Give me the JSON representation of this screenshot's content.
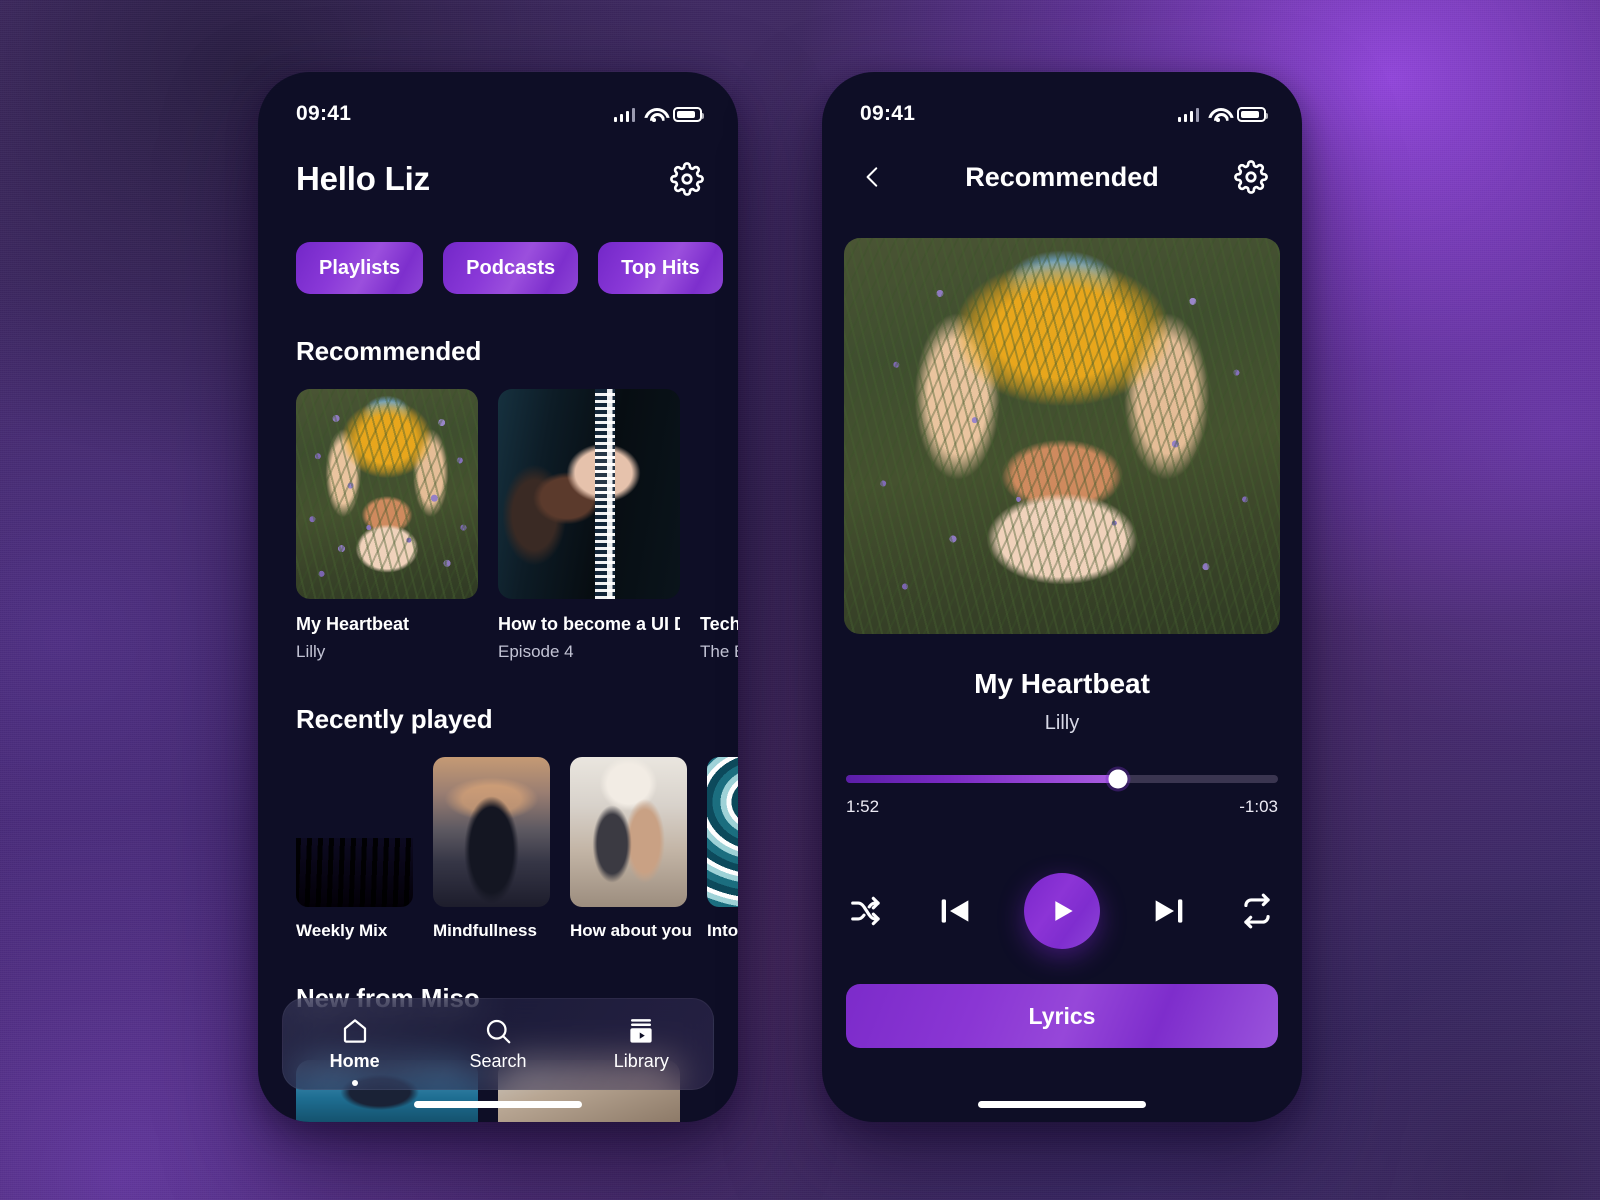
{
  "theme": {
    "screen_bg": "#0e0e26",
    "accent_purple": "#8a36d4",
    "accent_purple_dark": "#5b1ea8",
    "text_primary": "#ffffff",
    "text_secondary": "#c2c3d4",
    "backdrop_purple": "#4a3070"
  },
  "home_screen": {
    "status_bar": {
      "time": "09:41",
      "signal_icon": "cellular-signal-icon",
      "wifi_icon": "wifi-icon",
      "battery_icon": "battery-icon"
    },
    "greeting": "Hello Liz",
    "settings_icon": "gear-icon",
    "chips": [
      {
        "label": "Playlists"
      },
      {
        "label": "Podcasts"
      },
      {
        "label": "Top Hits"
      }
    ],
    "recommended": {
      "title": "Recommended",
      "items": [
        {
          "title": "My Heartbeat",
          "subtitle": "Lilly",
          "art": "art-lavender"
        },
        {
          "title": "How to become a UI D",
          "subtitle": "Episode 4",
          "art": "art-hands"
        },
        {
          "title": "Techni",
          "subtitle": "The Bols",
          "art": "art-radio"
        }
      ]
    },
    "recently_played": {
      "title": "Recently played",
      "items": [
        {
          "title": "Weekly Mix",
          "art": "art-concert"
        },
        {
          "title": "Mindfullness",
          "art": "art-sunset"
        },
        {
          "title": "How about you",
          "art": "art-friends"
        },
        {
          "title": "Intoxic",
          "art": "art-marble"
        }
      ]
    },
    "new_from": {
      "title": "New from Miso"
    },
    "tabbar": {
      "items": [
        {
          "label": "Home",
          "icon": "home-icon",
          "active": true
        },
        {
          "label": "Search",
          "icon": "search-icon",
          "active": false
        },
        {
          "label": "Library",
          "icon": "library-icon",
          "active": false
        }
      ]
    }
  },
  "player_screen": {
    "status_bar": {
      "time": "09:41",
      "signal_icon": "cellular-signal-icon",
      "wifi_icon": "wifi-icon",
      "battery_icon": "battery-icon"
    },
    "back_icon": "chevron-left-icon",
    "title": "Recommended",
    "settings_icon": "gear-icon",
    "cover_art": "art-lavender",
    "track_title": "My Heartbeat",
    "track_artist": "Lilly",
    "progress": {
      "elapsed": "1:52",
      "remaining": "-1:03",
      "percent": 63
    },
    "controls": {
      "shuffle_icon": "shuffle-icon",
      "previous_icon": "skip-previous-icon",
      "play_icon": "play-icon",
      "next_icon": "skip-next-icon",
      "repeat_icon": "repeat-icon"
    },
    "lyrics_label": "Lyrics"
  }
}
